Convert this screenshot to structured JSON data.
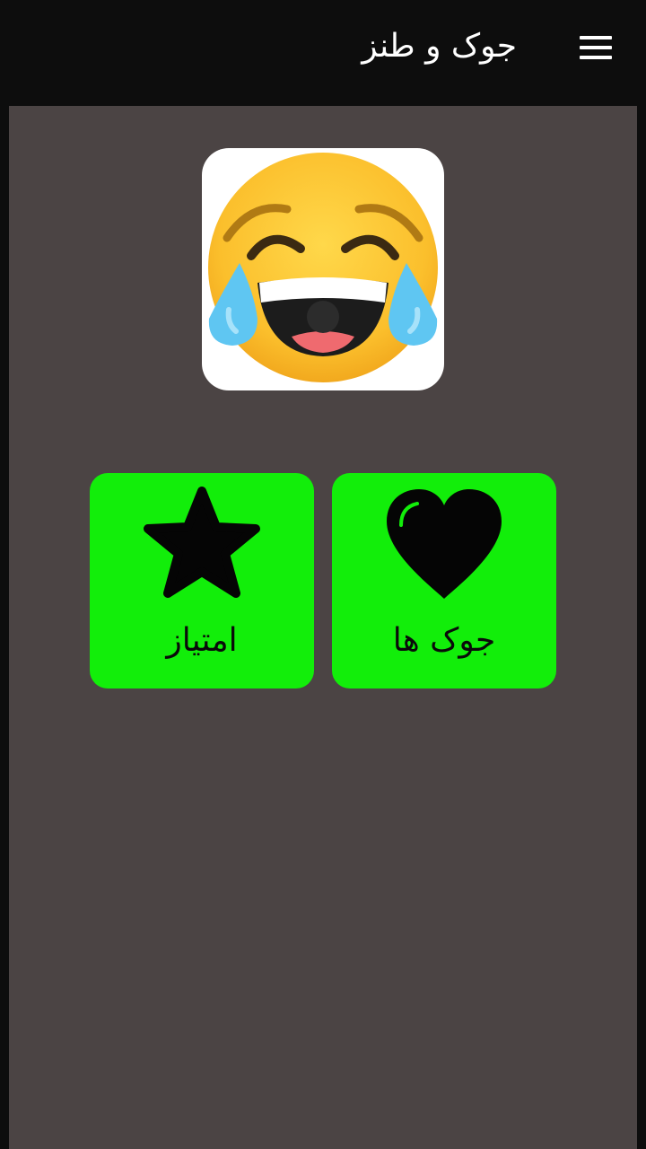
{
  "app_bar": {
    "title": "جوک و طنز",
    "menu_icon": "hamburger-menu-icon",
    "background": "#0d0d0d"
  },
  "main": {
    "background": "#4b4444",
    "logo_icon": "laughing-tears-emoji-icon",
    "tiles": [
      {
        "label": "امتیاز",
        "icon": "star-icon",
        "color": "#12ee0a"
      },
      {
        "label": "جوک ها",
        "icon": "heart-icon",
        "color": "#12ee0a"
      }
    ]
  }
}
